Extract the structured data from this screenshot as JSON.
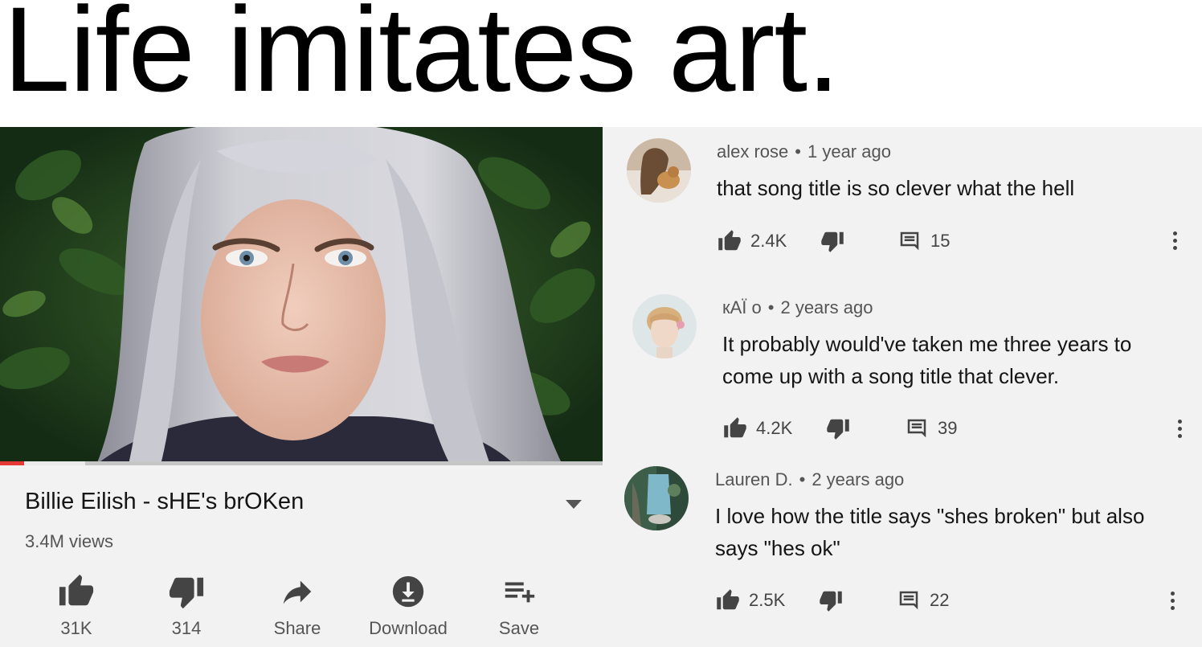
{
  "headline": "Life imitates art.",
  "video": {
    "title": "Billie Eilish - sHE's brOKen",
    "views": "3.4M views",
    "progress_played": 0.04,
    "actions": {
      "like": "31K",
      "dislike": "314",
      "share": "Share",
      "download": "Download",
      "save": "Save"
    }
  },
  "comments": [
    {
      "author": "alex rose",
      "time": "1 year ago",
      "text": "that song title is so clever what the hell",
      "likes": "2.4K",
      "replies": "15"
    },
    {
      "author": "кАЇ о",
      "time": "2 years ago",
      "text": "It probably would've taken me three years to come up with a song title that clever.",
      "likes": "4.2K",
      "replies": "39"
    },
    {
      "author": "Lauren D.",
      "time": "2 years ago",
      "text": "I love how the title says \"shes broken\" but also says \"hes ok\"",
      "likes": "2.5K",
      "replies": "22"
    }
  ],
  "colors": {
    "panel_background": "#f2f2f2",
    "progress_red": "#e53935",
    "icon_gray": "#444444"
  }
}
